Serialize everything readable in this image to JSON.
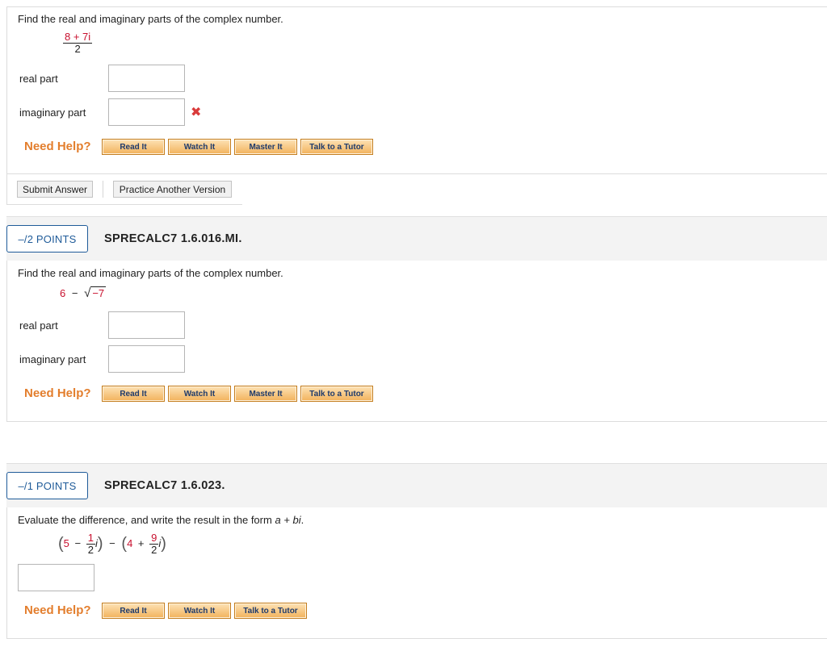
{
  "q1": {
    "prompt": "Find the real and imaginary parts of the complex number.",
    "expr_num": "8 + 7i",
    "expr_den": "2",
    "real_label": "real part",
    "imag_label": "imaginary part",
    "wrong_icon": "✖",
    "need_help": "Need Help?",
    "help_buttons": [
      "Read It",
      "Watch It",
      "Master It",
      "Talk to a Tutor"
    ],
    "submit_label": "Submit Answer",
    "practice_label": "Practice Another Version"
  },
  "q2": {
    "points": "–/2 POINTS",
    "code": "SPRECALC7 1.6.016.MI.",
    "prompt": "Find the real and imaginary parts of the complex number.",
    "expr_a": "6",
    "expr_op": "−",
    "expr_radicand": "−7",
    "real_label": "real part",
    "imag_label": "imaginary part",
    "need_help": "Need Help?",
    "help_buttons": [
      "Read It",
      "Watch It",
      "Master It",
      "Talk to a Tutor"
    ]
  },
  "q3": {
    "points": "–/1 POINTS",
    "code": "SPRECALC7 1.6.023.",
    "prompt_before": "Evaluate the difference, and write the result in the form ",
    "prompt_form": "a + bi",
    "prompt_after": ".",
    "expr_a": "5",
    "expr_minus1": "−",
    "frac1_num": "1",
    "frac1_den": "2",
    "i1": "i",
    "expr_minus2": "−",
    "expr_b": "4",
    "expr_plus": "+",
    "frac2_num": "9",
    "frac2_den": "2",
    "i2": "i",
    "need_help": "Need Help?",
    "help_buttons": [
      "Read It",
      "Watch It",
      "Talk to a Tutor"
    ]
  },
  "colors": {
    "accent": "#1f5b99",
    "need_help": "#e37e2d",
    "red": "#c8102e",
    "wrong": "#d93a3a"
  }
}
